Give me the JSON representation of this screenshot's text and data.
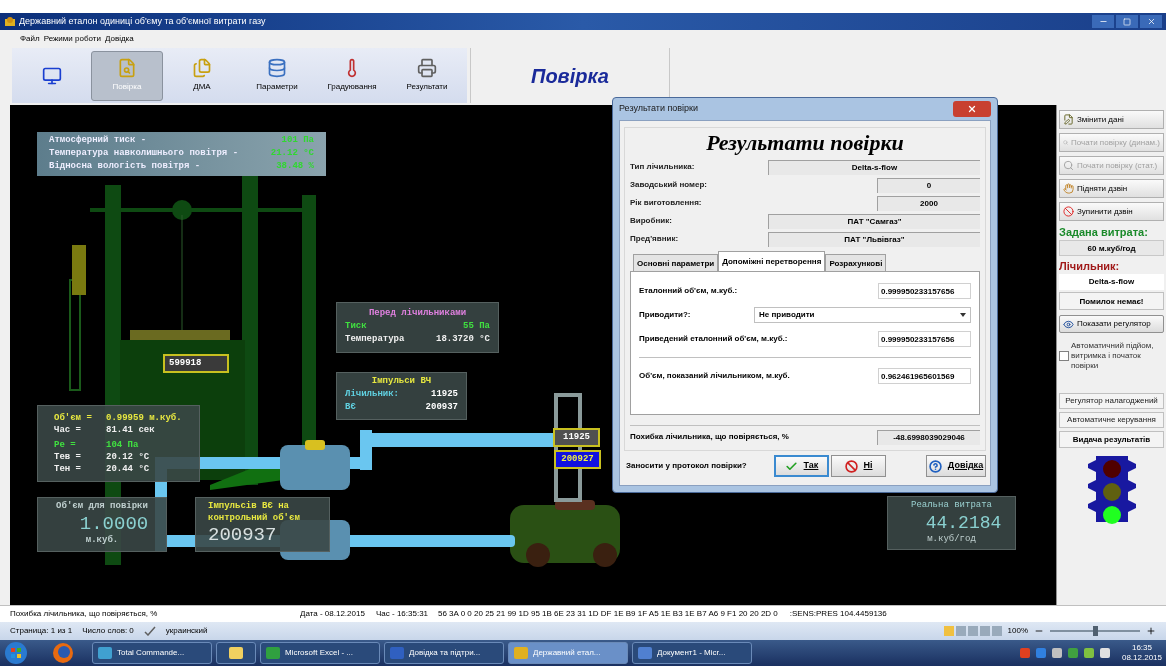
{
  "window": {
    "title": "Державний еталон одиниці об'єму та об'ємної витрати газу"
  },
  "menu": [
    "Файл",
    "Режими роботи",
    "Довідка"
  ],
  "toolbar": {
    "buttons": [
      {
        "kind": "monitor",
        "selected": false
      },
      {
        "kind": "search",
        "label": "Повірка",
        "selected": true
      },
      {
        "kind": "files",
        "label": "ДМА",
        "selected": false
      },
      {
        "kind": "database",
        "label": "Параметри",
        "selected": false
      },
      {
        "kind": "thermometer",
        "label": "Градуювання",
        "selected": false
      },
      {
        "kind": "printer",
        "label": "Результати",
        "selected": false
      }
    ],
    "mode_title": "Повірка"
  },
  "scene": {
    "atmosphere": [
      {
        "label": "Атмосферний тиск -",
        "value": "101 Па"
      },
      {
        "label": "Температура навколишнього повітря -",
        "value": "21.12 °C"
      },
      {
        "label": "Відносна вологість повітря -",
        "value": "38.48 %"
      }
    ],
    "tank_counter": "599918",
    "before_meters": {
      "title": "Перед лічильниками",
      "rows": [
        {
          "label": "Тиск",
          "value": "55 Па",
          "color": "#40e040"
        },
        {
          "label": "Температура",
          "value": "18.3720 °C",
          "color": "#f0f0f0"
        }
      ]
    },
    "pulses": {
      "title": "Імпульси ВЧ",
      "rows": [
        {
          "label": "Лічильник:",
          "value": "11925"
        },
        {
          "label": "ВЄ",
          "value": "200937"
        }
      ]
    },
    "measurement": [
      {
        "label": "Об'єм =",
        "value": "0.99959 м.куб.",
        "color": "#e8e840"
      },
      {
        "label": "Час =",
        "value": "81.41 сек",
        "color": "#f0f0f0"
      },
      {
        "label": "Ре =",
        "value": "104 Па",
        "color": "#40e040"
      },
      {
        "label": "Тев =",
        "value": "20.12 °C",
        "color": "#f0f0f0"
      },
      {
        "label": "Тен =",
        "value": "20.44 °C",
        "color": "#f0f0f0"
      }
    ],
    "verify_volume": {
      "title": "Об'єм для повірки",
      "value": "1.0000",
      "unit": "м.куб."
    },
    "control_pulses": {
      "title": "Імпульсів ВЄ на контрольний об'єм",
      "value": "200937"
    },
    "meter_display": [
      "11925",
      "200927"
    ],
    "real_flow": {
      "title": "Реальна витрата",
      "value": "44.2184",
      "unit": "м.куб/год"
    }
  },
  "dialog": {
    "title": "Результати повірки",
    "heading": "Результати повірки",
    "fields": [
      {
        "label": "Тип лічильника:",
        "value": "Delta-s-flow",
        "kind": "wide"
      },
      {
        "label": "Заводський номер:",
        "value": "0",
        "kind": "narrow"
      },
      {
        "label": "Рік виготовлення:",
        "value": "2000",
        "kind": "narrow"
      },
      {
        "label": "Виробник:",
        "value": "ПАТ \"Самгаз\"",
        "kind": "wide"
      },
      {
        "label": "Пред'явник:",
        "value": "ПАТ \"Львівгаз\"",
        "kind": "wide"
      }
    ],
    "tabs": [
      {
        "label": "Основні параметри",
        "selected": false
      },
      {
        "label": "Допоміжні перетворення",
        "selected": true
      },
      {
        "label": "Розрахункові",
        "selected": false
      }
    ],
    "tab_rows": [
      {
        "kind": "field",
        "label": "Еталонний об'єм, м.куб.:",
        "value": "0.999950233157656"
      },
      {
        "kind": "select",
        "label": "Приводити?:",
        "value": "Не приводити"
      },
      {
        "kind": "field",
        "label": "Приведений еталонний об'єм, м.куб.:",
        "value": "0.999950233157656"
      },
      {
        "kind": "divider"
      },
      {
        "kind": "field",
        "label": "Об'єм, показаний лічильником, м.куб.",
        "value": "0.962461965601569"
      }
    ],
    "error": {
      "label": "Похибка лічильника, що повіряється, %",
      "value": "-48.6998039029046"
    },
    "prompt": "Заносити у протокол повірки?",
    "buttons": [
      {
        "kind": "yes",
        "label": "Так",
        "selected": true
      },
      {
        "kind": "no",
        "label": "Ні",
        "selected": false
      },
      {
        "kind": "help",
        "label": "Довідка",
        "selected": false
      }
    ]
  },
  "side_panel": {
    "buttons": [
      {
        "kind": "edit",
        "label": "Змінити дані",
        "disabled": false
      },
      {
        "kind": "search",
        "label": "Почати повірку (динам.)",
        "disabled": true
      },
      {
        "kind": "search",
        "label": "Почати повірку (стат.)",
        "disabled": true
      },
      {
        "kind": "raise",
        "label": "Підняти дзвін",
        "disabled": false
      },
      {
        "kind": "stop",
        "label": "Зупинити дзвін",
        "disabled": false
      }
    ],
    "set_flow_label": "Задана витрата:",
    "set_flow": "60 м.куб/год",
    "meter_label": "Лічильник:",
    "meter": "Delta-s-flow",
    "status": "Помилок немає!",
    "show_regulator": "Показати регулятор",
    "auto_start": {
      "label": "Автоматичний підйом, витримка і початок повірки",
      "checked": false
    },
    "modes": [
      "Регулятор налагоджений",
      "Автоматичне керування"
    ],
    "results": "Видача результатів",
    "lights": [
      {
        "on": false
      },
      {
        "on": false
      },
      {
        "on": true
      }
    ]
  },
  "status_line": [
    "Похибка лічильника, що повіряється, %",
    "Дата - 08.12.2015",
    "Час - 16:35:31",
    "56 3A 0 0 20 25 21 99 1D 95 1B 6E 23 31 1D DF 1E B9 1F A5 1E B3 1E B7 A6 9 F1 20 20 2D 0",
    ":SENS:PRES 104.4459136"
  ],
  "word_status": {
    "page": "Страница: 1 из 1",
    "words": "Число слов: 0",
    "language": "украинский",
    "zoom": "100%",
    "zoom_slider": {
      "level": 0.5
    }
  },
  "taskbar": {
    "items": [
      {
        "label": "Total Commande...",
        "selected": false
      },
      {
        "selected": false
      },
      {
        "label": "Microsoft Excel - ...",
        "selected": false
      },
      {
        "label": "Довідка та підтри...",
        "selected": false
      },
      {
        "label": "Державний етал...",
        "selected": true
      },
      {
        "label": "Документ1 - Micr...",
        "selected": false
      }
    ],
    "time": "16:35",
    "date": "08.12.2015"
  }
}
